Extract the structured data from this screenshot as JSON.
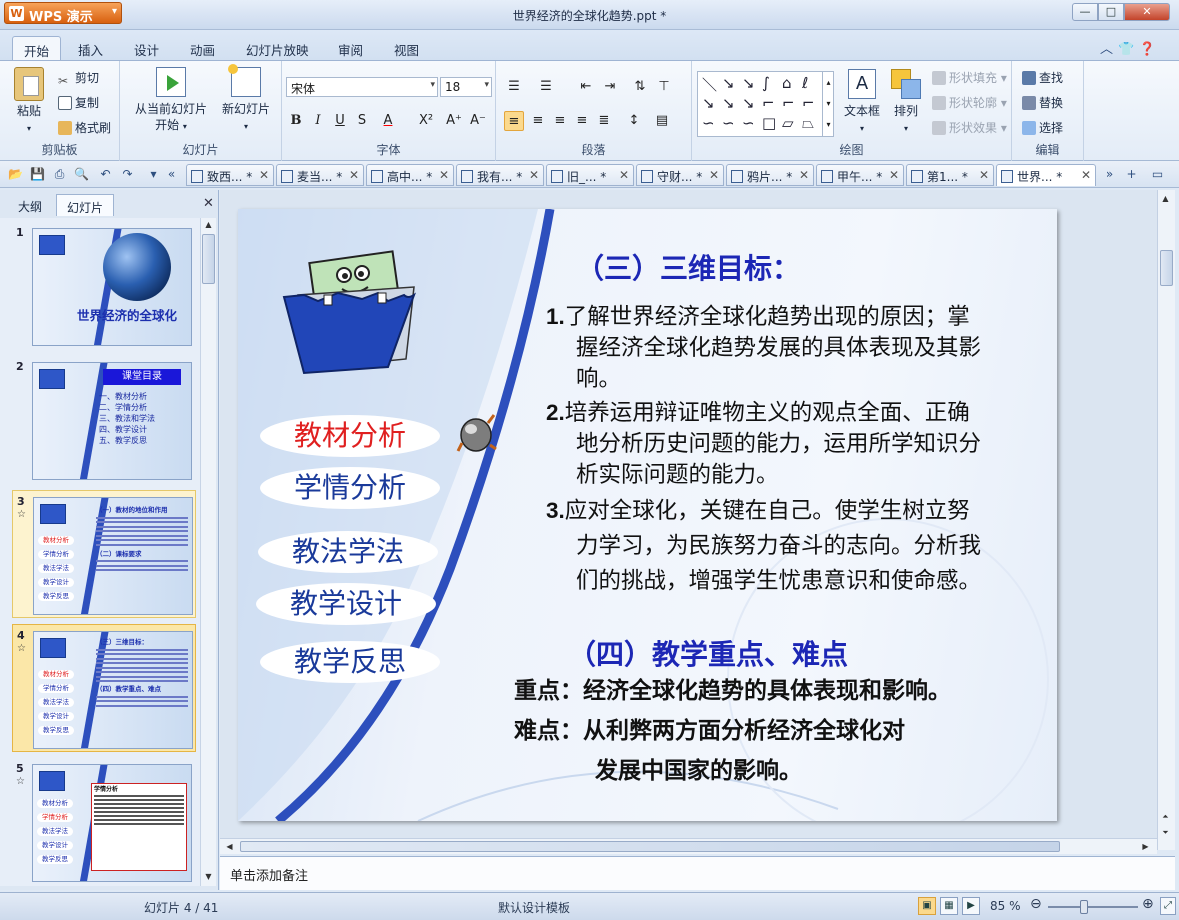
{
  "app": {
    "name": "WPS 演示",
    "document_title": "世界经济的全球化趋势.ppt *"
  },
  "window": {
    "minimize": "—",
    "maximize": "□",
    "close": "✕"
  },
  "menu_tabs": [
    "开始",
    "插入",
    "设计",
    "动画",
    "幻灯片放映",
    "审阅",
    "视图"
  ],
  "ribbon": {
    "clipboard": {
      "paste": "粘贴",
      "cut": "剪切",
      "copy": "复制",
      "format_painter": "格式刷",
      "group": "剪贴板"
    },
    "slides": {
      "from_current": "从当前幻灯片",
      "from_current2": "开始",
      "new_slide": "新幻灯片",
      "group": "幻灯片"
    },
    "font": {
      "name": "宋体",
      "size": "18",
      "group": "字体"
    },
    "paragraph": {
      "group": "段落"
    },
    "drawing": {
      "textbox": "文本框",
      "arrange": "排列",
      "shape_fill": "形状填充",
      "shape_outline": "形状轮廓",
      "shape_effect": "形状效果",
      "group": "绘图"
    },
    "editing": {
      "find": "查找",
      "replace": "替换",
      "select": "选择",
      "group": "编辑"
    }
  },
  "doc_tabs": [
    "致西... *",
    "麦当... *",
    "高中... *",
    "我有... *",
    "旧_... *",
    "守财... *",
    "鸦片... *",
    "甲午... *",
    "第1... *",
    "世界... *"
  ],
  "left_pane": {
    "tab_outline": "大纲",
    "tab_slides": "幻灯片",
    "close": "✕"
  },
  "thumbnails": [
    {
      "num": "1",
      "title": "世界经济的全球化"
    },
    {
      "num": "2",
      "title": "课堂目录",
      "items": "一、教材分析\n二、学情分析\n三、教法和学法\n四、教学设计\n五、教学反思"
    },
    {
      "num": "3",
      "star": "☆",
      "head1": "（一）教材的地位和作用",
      "head2": "（二）课标要求"
    },
    {
      "num": "4",
      "star": "☆",
      "head1": "（三）三维目标：",
      "head2": "（四）教学重点、难点"
    },
    {
      "num": "5",
      "star": "☆",
      "head1": "学情分析"
    }
  ],
  "thumb_menu": [
    "教材分析",
    "学情分析",
    "教法学法",
    "教学设计",
    "教学反思"
  ],
  "slide": {
    "menu": [
      "教材分析",
      "学情分析",
      "教法学法",
      "教学设计",
      "教学反思"
    ],
    "active_menu": "教材分析",
    "heading1": "（三）三维目标：",
    "objectives": [
      {
        "n": "1.",
        "first": "了解世界经济全球化趋势出现的原因；掌",
        "rest": [
          "握经济全球化趋势发展的具体表现及其影",
          "响。"
        ]
      },
      {
        "n": "2.",
        "first": "培养运用辩证唯物主义的观点全面、正确",
        "rest": [
          "地分析历史问题的能力，运用所学知识分",
          "析实际问题的能力。"
        ]
      },
      {
        "n": "3.",
        "first": "应对全球化，关键在自己。使学生树立努",
        "rest": [
          "力学习，为民族努力奋斗的志向。分析我",
          "们的挑战，增强学生忧患意识和使命感。"
        ]
      }
    ],
    "heading2": "（四）教学重点、难点",
    "key_point": "重点：经济全球化趋势的具体表现和影响。",
    "difficult_point": "难点：从利弊两方面分析经济全球化对",
    "difficult_point2": "发展中国家的影响。"
  },
  "notes_placeholder": "单击添加备注",
  "status": {
    "slide_pos": "幻灯片 4 / 41",
    "template": "默认设计模板",
    "zoom": "85 %"
  },
  "colors": {
    "accent_blue": "#1c27b5",
    "active_red": "#e02020"
  }
}
